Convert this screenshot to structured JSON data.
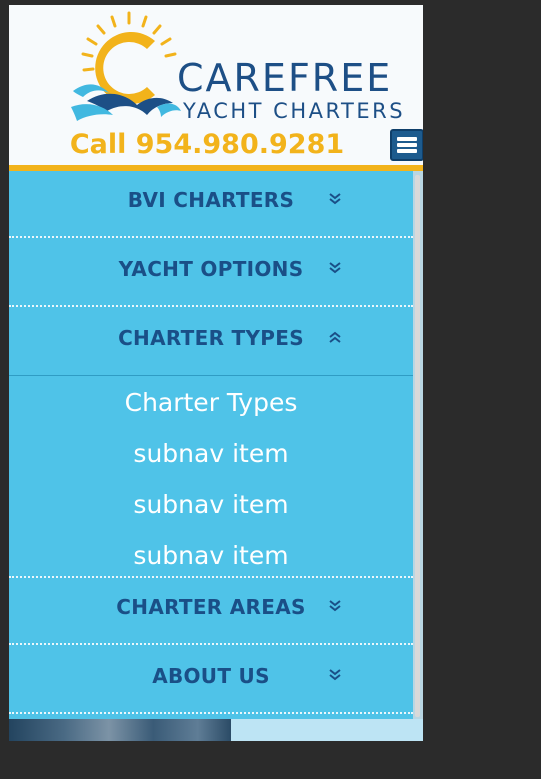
{
  "brand": {
    "name": "CAREFREE",
    "subtitle": "YACHT CHARTERS",
    "phone": "Call 954.980.9281",
    "colors": {
      "navy": "#1d4f86",
      "gold": "#f2b31b",
      "sky": "#4fc3e8",
      "wave": "#41b8e0"
    }
  },
  "header": {
    "menu_icon": "hamburger-menu-icon"
  },
  "nav": {
    "items": [
      {
        "label": "BVI CHARTERS",
        "icon": "chevron-double-down-icon",
        "expanded": false
      },
      {
        "label": "YACHT OPTIONS",
        "icon": "chevron-double-down-icon",
        "expanded": false
      },
      {
        "label": "CHARTER TYPES",
        "icon": "chevron-double-up-icon",
        "expanded": true
      },
      {
        "label": "CHARTER AREAS",
        "icon": "chevron-double-down-icon",
        "expanded": false
      },
      {
        "label": "ABOUT US",
        "icon": "chevron-double-down-icon",
        "expanded": false
      }
    ],
    "subitems": [
      "Charter Types",
      "subnav item",
      "subnav item",
      "subnav item"
    ]
  }
}
